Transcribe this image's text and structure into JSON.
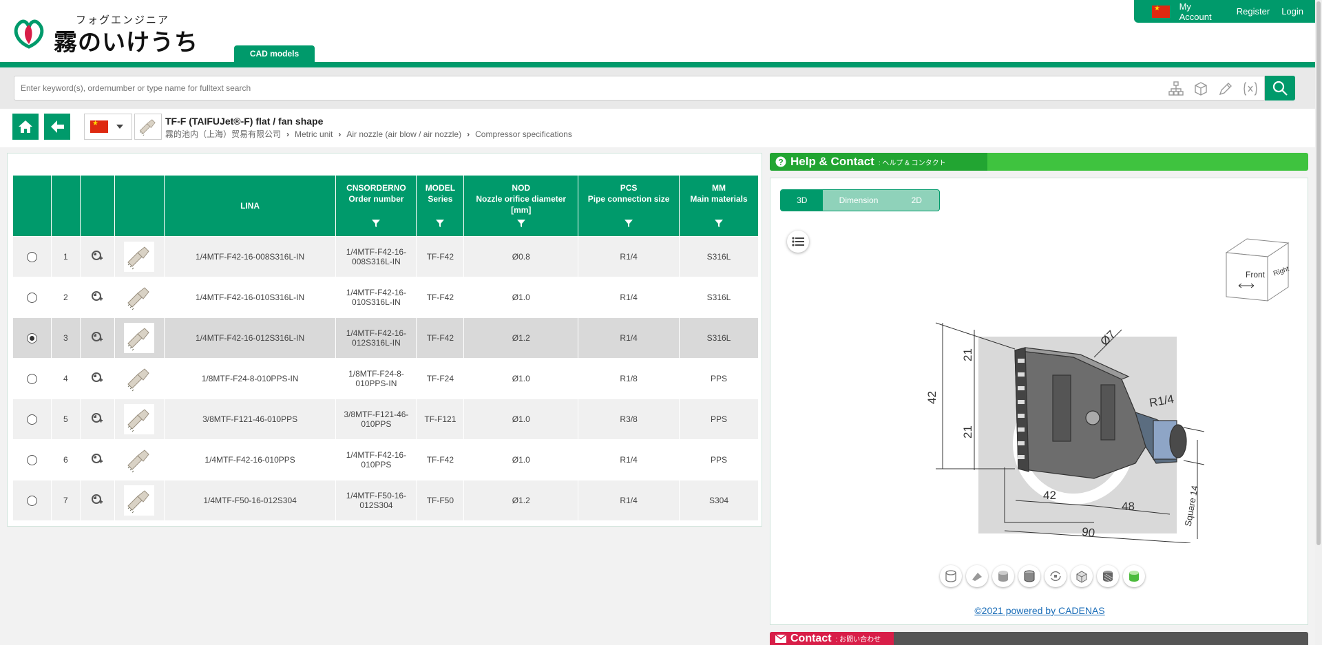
{
  "logo": {
    "kana": "フォグエンジニア",
    "main": "霧のいけうち",
    "reg": "®"
  },
  "tabs": {
    "cad_models": "CAD models"
  },
  "topnav": {
    "my_account": "My Account",
    "register": "Register",
    "login": "Login"
  },
  "search": {
    "placeholder": "Enter keyword(s), ordernumber or type name for fulltext search"
  },
  "product": {
    "title": "TF-F (TAIFUJet®-F) flat / fan shape",
    "breadcrumbs": [
      "霧的池内（上海）贸易有限公司",
      "Metric unit",
      "Air nozzle (air blow / air nozzle)",
      "Compressor specifications"
    ]
  },
  "table": {
    "headers": {
      "lina": "LINA",
      "cnsorderno": "CNSORDERNO",
      "cnsorderno_sub": "Order number",
      "model": "MODEL",
      "model_sub": "Series",
      "nod": "NOD",
      "nod_sub": "Nozzle orifice diameter",
      "nod_unit": "[mm]",
      "pcs": "PCS",
      "pcs_sub": "Pipe connection size",
      "mm": "MM",
      "mm_sub": "Main materials"
    },
    "rows": [
      {
        "n": "1",
        "lina": "1/4MTF-F42-16-008S316L-IN",
        "order1": "1/4MTF-F42-16-",
        "order2": "008S316L-IN",
        "model": "TF-F42",
        "nod": "Ø0.8",
        "pcs": "R1/4",
        "mm": "S316L"
      },
      {
        "n": "2",
        "lina": "1/4MTF-F42-16-010S316L-IN",
        "order1": "1/4MTF-F42-16-",
        "order2": "010S316L-IN",
        "model": "TF-F42",
        "nod": "Ø1.0",
        "pcs": "R1/4",
        "mm": "S316L"
      },
      {
        "n": "3",
        "lina": "1/4MTF-F42-16-012S316L-IN",
        "order1": "1/4MTF-F42-16-",
        "order2": "012S316L-IN",
        "model": "TF-F42",
        "nod": "Ø1.2",
        "pcs": "R1/4",
        "mm": "S316L"
      },
      {
        "n": "4",
        "lina": "1/8MTF-F24-8-010PPS-IN",
        "order1": "1/8MTF-F24-8-",
        "order2": "010PPS-IN",
        "model": "TF-F24",
        "nod": "Ø1.0",
        "pcs": "R1/8",
        "mm": "PPS"
      },
      {
        "n": "5",
        "lina": "3/8MTF-F121-46-010PPS",
        "order1": "3/8MTF-F121-46-",
        "order2": "010PPS",
        "model": "TF-F121",
        "nod": "Ø1.0",
        "pcs": "R3/8",
        "mm": "PPS"
      },
      {
        "n": "6",
        "lina": "1/4MTF-F42-16-010PPS",
        "order1": "1/4MTF-F42-16-",
        "order2": "010PPS",
        "model": "TF-F42",
        "nod": "Ø1.0",
        "pcs": "R1/4",
        "mm": "PPS"
      },
      {
        "n": "7",
        "lina": "1/4MTF-F50-16-012S304",
        "order1": "1/4MTF-F50-16-",
        "order2": "012S304",
        "model": "TF-F50",
        "nod": "Ø1.2",
        "pcs": "R1/4",
        "mm": "S304"
      }
    ],
    "selected_row": 3
  },
  "help": {
    "title": "Help & Contact",
    "sub": ": ヘルプ & コンタクト"
  },
  "viewer": {
    "tabs": [
      "3D",
      "Dimension",
      "2D"
    ],
    "cube": {
      "front": "Front",
      "right": "Right"
    },
    "dims": {
      "h_total": "42",
      "h_top": "21",
      "h_bottom": "21",
      "dia": "Ø7",
      "thread": "R1/4",
      "w_body": "42",
      "w_neck": "48",
      "w_total": "90",
      "square": "Square 14"
    },
    "powered": "©2021 powered by CADENAS"
  },
  "contact": {
    "title": "Contact",
    "sub": ": お問い合わせ"
  },
  "colors": {
    "brand_green": "#009a6b",
    "help_green": "#3fc33f",
    "contact_red": "#d81e48"
  }
}
